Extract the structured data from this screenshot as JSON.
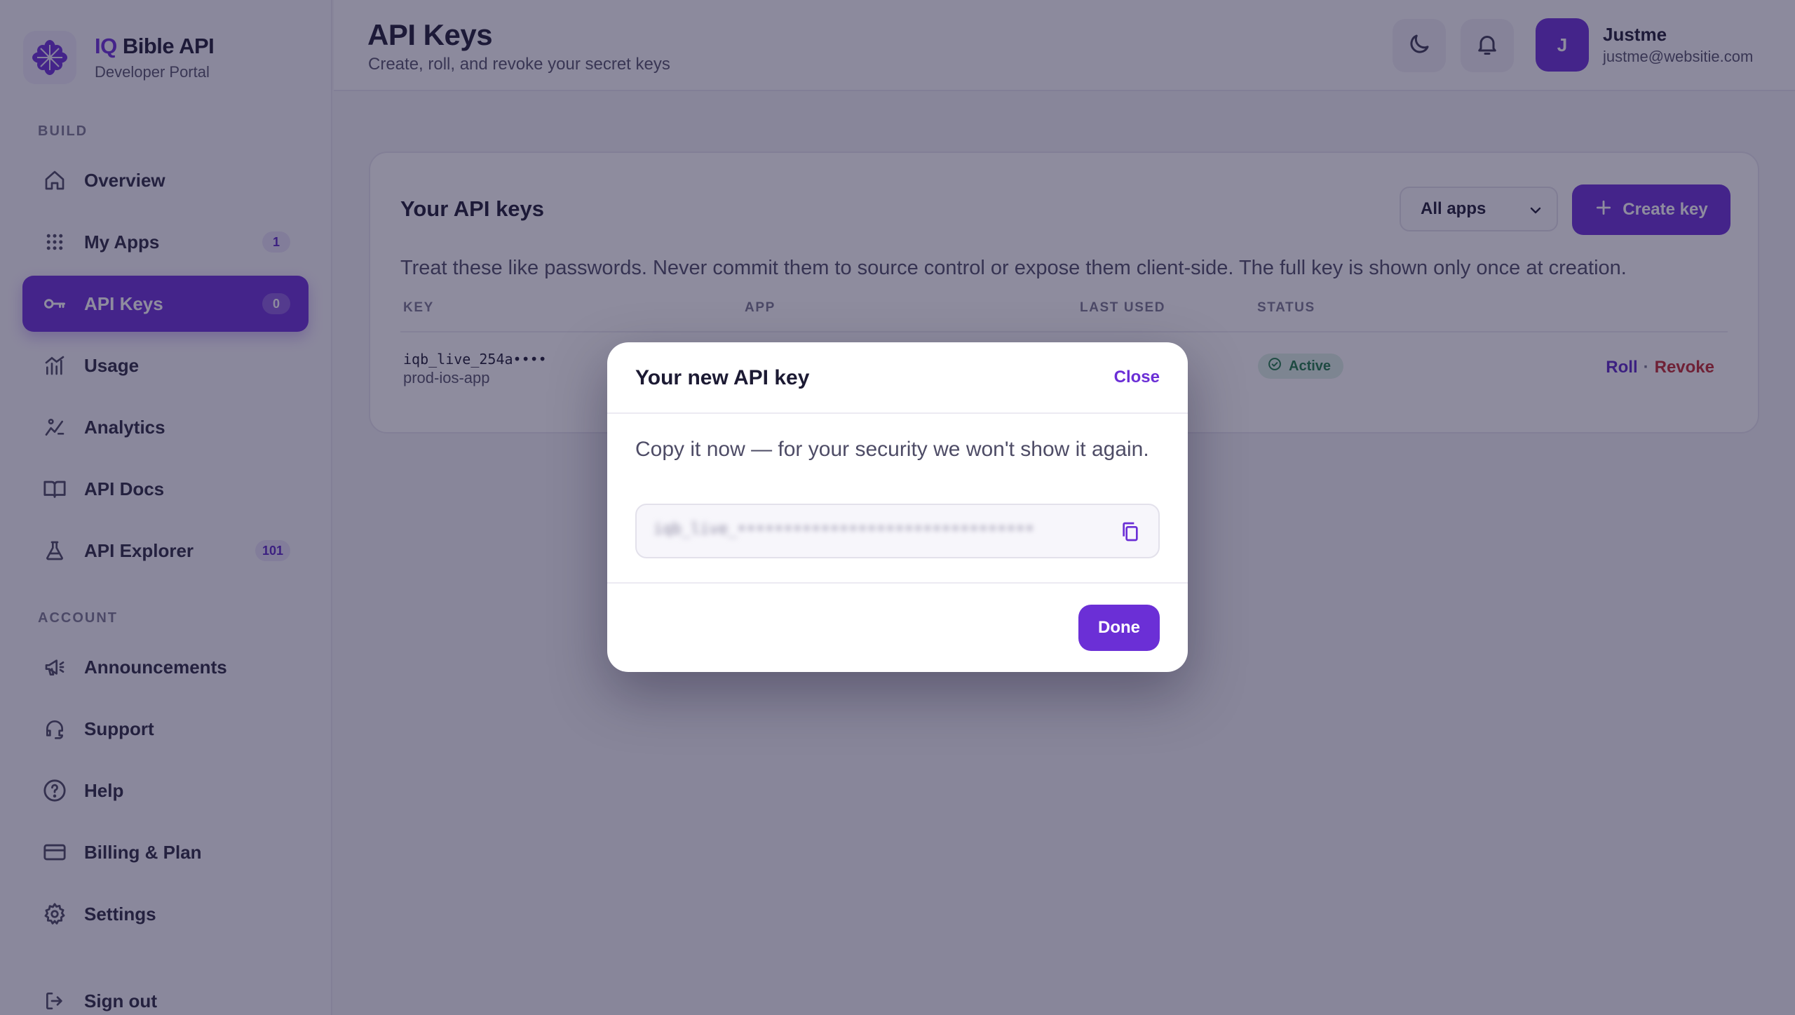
{
  "brand": {
    "accent": "IQ",
    "title": "Bible API",
    "subtitle": "Developer Portal",
    "logo_icon": "flower-logo-icon",
    "color": "#6b2fd6"
  },
  "sidebar": {
    "sections": [
      {
        "label": "BUILD"
      },
      {
        "label": "ACCOUNT"
      }
    ],
    "items": [
      {
        "label": "Overview",
        "icon": "home-icon"
      },
      {
        "label": "My Apps",
        "icon": "grid-icon",
        "badge": "1"
      },
      {
        "label": "API Keys",
        "icon": "key-icon",
        "badge": "0",
        "active": true
      },
      {
        "label": "Usage",
        "icon": "bar-chart-icon"
      },
      {
        "label": "Analytics",
        "icon": "analytics-icon"
      },
      {
        "label": "API Docs",
        "icon": "book-icon"
      },
      {
        "label": "API Explorer",
        "icon": "flask-icon",
        "badge": "101"
      },
      {
        "label": "Announcements",
        "icon": "megaphone-icon"
      },
      {
        "label": "Support",
        "icon": "headset-icon"
      },
      {
        "label": "Help",
        "icon": "help-icon"
      },
      {
        "label": "Billing & Plan",
        "icon": "credit-card-icon"
      },
      {
        "label": "Settings",
        "icon": "gear-icon"
      },
      {
        "label": "Sign out",
        "icon": "sign-out-icon"
      }
    ]
  },
  "header": {
    "title": "API Keys",
    "subtitle": "Create, roll, and revoke your secret keys",
    "theme_icon": "moon-icon",
    "notification_icon": "bell-icon",
    "user": {
      "initial": "J",
      "name": "Justme",
      "email": "justme@websitie.com"
    }
  },
  "card": {
    "title": "Your API keys",
    "filter": {
      "selected": "All apps"
    },
    "create_label": "Create key",
    "note": "Treat these like passwords. Never commit them to source control or expose them client-side. The full key is shown only once at creation.",
    "columns": [
      "KEY",
      "APP",
      "LAST USED",
      "STATUS"
    ],
    "rows": [
      {
        "key": "iqb_live_254a••••",
        "key_name": "prod-ios-app",
        "status": "Active",
        "actions": {
          "roll": "Roll",
          "separator": "·",
          "revoke": "Revoke"
        }
      }
    ]
  },
  "modal": {
    "title": "Your new API key",
    "close_label": "Close",
    "message": "Copy it now — for your security we won't show it again.",
    "key_value": "iqb_live_••••••••••••••••••••••••••••••••",
    "copy_icon": "copy-icon",
    "done_label": "Done"
  },
  "colors": {
    "primary": "#6b2fd6",
    "status_active_bg": "#dcf1e4",
    "status_active_fg": "#1e7a47",
    "danger": "#c0282f",
    "overlay": "rgba(30,26,62,0.5)"
  }
}
